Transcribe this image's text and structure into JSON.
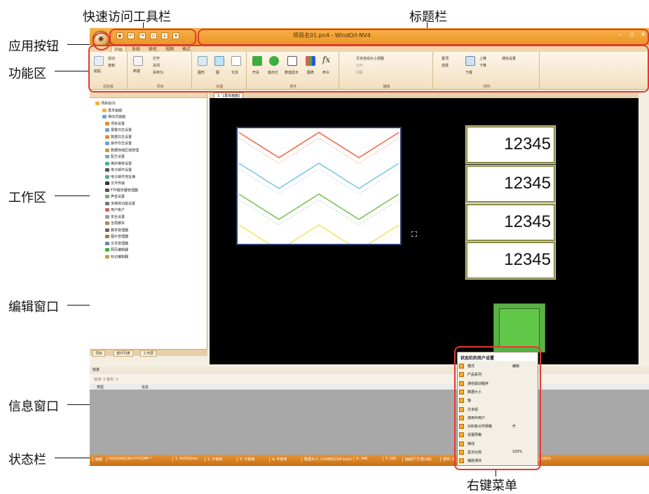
{
  "callouts": {
    "quick_access": "快速访问工具栏",
    "title_bar": "标题栏",
    "app_button": "应用按钮",
    "ribbon": "功能区",
    "work_area": "工作区",
    "edit_window": "编辑窗口",
    "info_window": "信息窗口",
    "status_bar": "状态栏",
    "context_menu": "右键菜单"
  },
  "window": {
    "title": "项目名01.pn4 - WindO/I-NV4",
    "controls": [
      "–",
      "▫",
      "✕"
    ]
  },
  "ribbon_tabs": [
    "开始",
    "系统",
    "联机",
    "视图",
    "格式"
  ],
  "ribbon": {
    "groups": [
      {
        "label": "剪贴板",
        "items": [
          "剪切",
          "复制",
          "粘贴"
        ]
      },
      {
        "label": "项目",
        "items": [
          "新建",
          "打开",
          "关闭",
          "另存为"
        ]
      },
      {
        "label": "绘图",
        "items": [
          "图形",
          "图",
          "文本"
        ]
      },
      {
        "label": "部件",
        "items": [
          "开关",
          "指示灯",
          "数值显示",
          "图表",
          "命令"
        ]
      },
      {
        "label": "编辑",
        "items": [
          "文本自动大小调整",
          "对齐",
          "间距"
        ]
      },
      {
        "label": "排列",
        "items": [
          "置顶",
          "选择",
          "上移",
          "下移",
          "下载",
          "通信设置"
        ]
      }
    ],
    "fx_label": "fx"
  },
  "work_area": {
    "header": "项目名01",
    "tree": [
      "项目名01",
      "基本画面",
      "弹出式画面",
      "项目设置",
      "报警日志设置",
      "数据日志设置",
      "操作日志设置",
      "数据存储区域管理",
      "配方设置",
      "维护维修设置",
      "电子邮件设置",
      "电子邮件地址簿",
      "文件传输",
      "FTP服务器管理器",
      "声音设置",
      "多媒体功能设置",
      "用户帐户",
      "安全设置",
      "全局脚本",
      "脚本管理器",
      "图片管理器",
      "文本管理器",
      "网页编辑器",
      "标记编辑器"
    ],
    "tabs": [
      "项目",
      "部件列表",
      "工作屏"
    ]
  },
  "editor": {
    "tab_label": "1 : [基本画面]",
    "numeric_displays": [
      "12345",
      "12345",
      "12345",
      "12345"
    ]
  },
  "info_window": {
    "title": "信息",
    "toolbar": "错误: 0    警告: 0",
    "col_type": "类型",
    "col_message": "信息"
  },
  "status_bar": {
    "items": [
      "画面",
      "HG5G/4G/3G-V*F22MF-*",
      "1: KVSS5mm",
      "2: 不使用",
      "3: 不使用",
      "4: 不使用",
      "数据大小: 5%MB(0/1M byte)",
      "X: 348",
      "Y: 182",
      "画面尺寸(宽×高)",
      "部件: 0",
      "100%"
    ]
  },
  "context_menu": {
    "title": "状态栏的用户设置",
    "items": [
      {
        "label": "模式",
        "value": "编辑"
      },
      {
        "label": "产品系列",
        "value": ""
      },
      {
        "label": "通信驱动程序",
        "value": ""
      },
      {
        "label": "数据大小",
        "value": ""
      },
      {
        "label": "轴",
        "value": ""
      },
      {
        "label": "文本组",
        "value": ""
      },
      {
        "label": "使用中用户",
        "value": ""
      },
      {
        "label": "对封象对齐网格",
        "value": "开"
      },
      {
        "label": "设置网格",
        "value": ""
      },
      {
        "label": "拷线",
        "value": ""
      },
      {
        "label": "显示比例",
        "value": "100%"
      },
      {
        "label": "缩放滑块",
        "value": ""
      }
    ]
  },
  "chart_data": {
    "type": "line",
    "x": [
      0,
      1,
      2,
      3,
      4
    ],
    "series": [
      {
        "values": [
          1,
          0,
          1,
          0,
          1
        ],
        "color": "#f26b4b"
      },
      {
        "values": [
          1,
          0,
          1,
          0,
          1
        ],
        "color": "#7fc6e6"
      },
      {
        "values": [
          1,
          0,
          1,
          0,
          1
        ],
        "color": "#7cc25a"
      },
      {
        "values": [
          1,
          0,
          1,
          0,
          1
        ],
        "color": "#f2e36c"
      }
    ]
  }
}
